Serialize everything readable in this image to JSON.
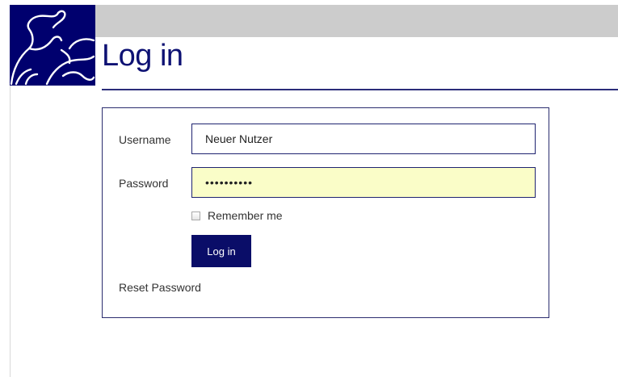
{
  "header": {
    "logo_icon": "bull-and-bear-logo-icon",
    "title": "Log in"
  },
  "form": {
    "username_label": "Username",
    "username_value": "Neuer Nutzer",
    "password_label": "Password",
    "password_value": "••••••••••",
    "remember_label": "Remember me",
    "remember_checked": false,
    "login_button": "Log in",
    "reset_link": "Reset Password"
  },
  "colors": {
    "brand_navy": "#0a0d68",
    "top_bar": "#cccccc",
    "password_field_bg": "#fafdc8"
  }
}
